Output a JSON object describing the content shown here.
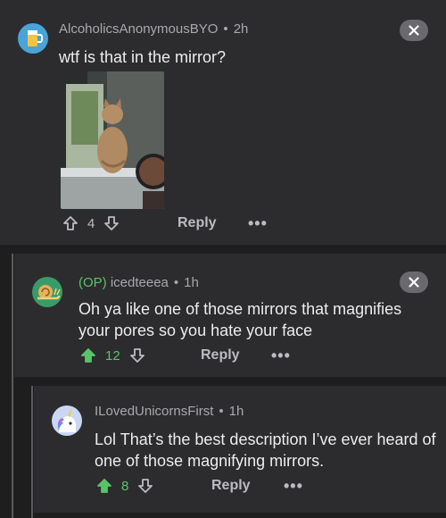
{
  "comments": [
    {
      "author": "AlcoholicsAnonymousBYO",
      "time": "2h",
      "body": "wtf is that in the mirror?",
      "votes": "4",
      "reply_label": "Reply",
      "more_label": "•••",
      "upvoted": false
    },
    {
      "op_tag": "(OP)",
      "author": "icedteeea",
      "time": "1h",
      "body": "Oh ya like one of those mirrors that magnifies your pores so you hate your face",
      "votes": "12",
      "reply_label": "Reply",
      "more_label": "•••",
      "upvoted": true
    },
    {
      "author": "ILovedUnicornsFirst",
      "time": "1h",
      "body": "Lol That’s the best description I’ve ever heard of one of those magnifying mirrors.",
      "votes": "8",
      "reply_label": "Reply",
      "more_label": "•••",
      "upvoted": true
    }
  ],
  "colors": {
    "background": "#1e1e1f",
    "card": "#2c2c2e",
    "upvote_active": "#58c46a",
    "op_tag": "#5ec16a",
    "meta_text": "#a9a9ad"
  }
}
